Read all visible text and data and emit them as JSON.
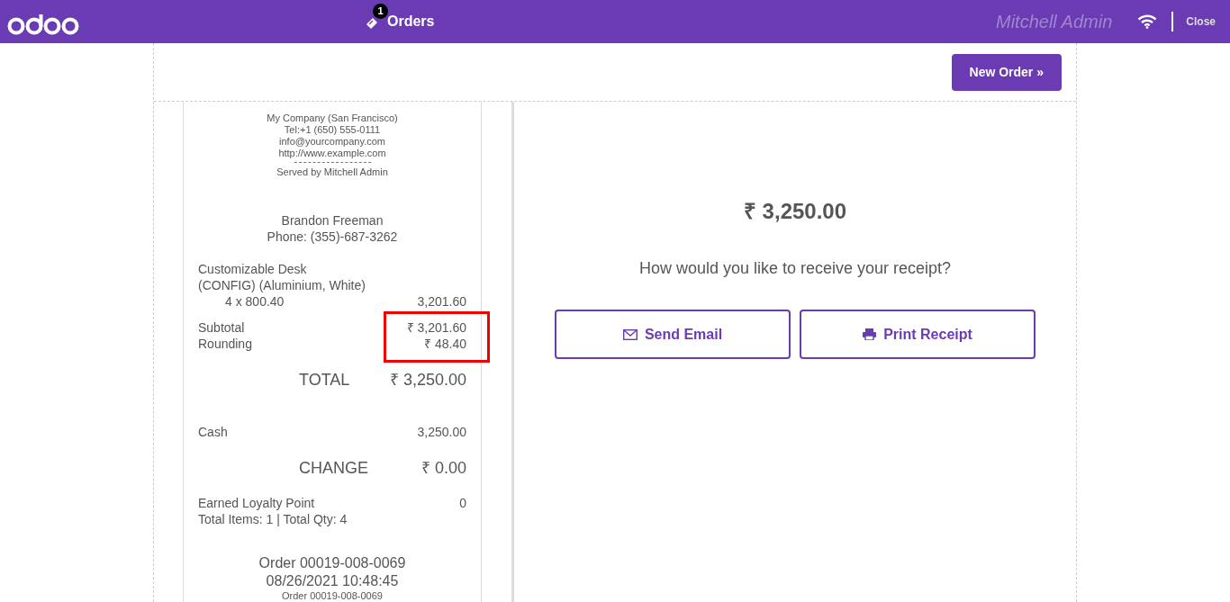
{
  "header": {
    "orders_label": "Orders",
    "orders_count": "1",
    "user": "Mitchell Admin",
    "close": "Close"
  },
  "new_order": {
    "label": "New Order",
    "arrow": "»"
  },
  "receipt": {
    "company_lines": [
      "My Company (San Francisco)",
      "Tel:+1 (650) 555-0111",
      "info@yourcompany.com",
      "http://www.example.com"
    ],
    "served_by": "Served by Mitchell Admin",
    "customer": [
      "Brandon Freeman",
      "Phone: (355)-687-3262"
    ],
    "lines": [
      {
        "product": "Customizable Desk\n(CONFIG) (Aluminium, White)",
        "qty": "4 x 800.40",
        "price": "3,201.60"
      }
    ],
    "subtotals": [
      {
        "label": "Subtotal",
        "value": "₹ 3,201.60"
      },
      {
        "label": "Rounding",
        "value": "₹ 48.40"
      }
    ],
    "total": {
      "label": "TOTAL",
      "value": "₹ 3,250.00"
    },
    "payments": [
      {
        "label": "Cash",
        "value": "3,250.00"
      }
    ],
    "change": {
      "label": "CHANGE",
      "value": "₹ 0.00"
    },
    "loyalty": {
      "label": "Earned Loyalty Point",
      "value": "0"
    },
    "counts": "Total Items: 1 | Total Qty: 4",
    "footer": [
      "Order 00019-008-0069",
      "08/26/2021 10:48:45"
    ],
    "footer_small": "Order 00019-008-0069"
  },
  "summary": {
    "amount": "₹ 3,250.00",
    "question": "How would you like to receive your receipt?",
    "buttons": [
      {
        "kind": "email",
        "label": "Send Email"
      },
      {
        "kind": "print",
        "label": "Print Receipt"
      }
    ]
  }
}
